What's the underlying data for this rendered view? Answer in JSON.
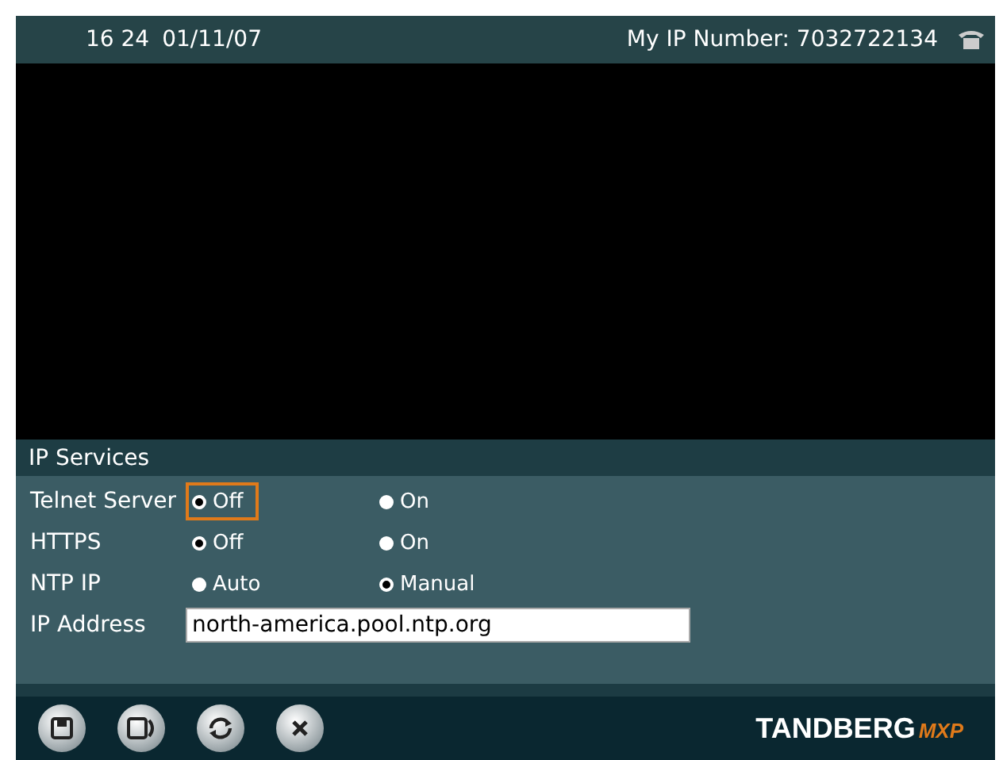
{
  "status_bar": {
    "time": "16 24",
    "date": "01/11/07",
    "ip_number": "My IP Number: 7032722134"
  },
  "panel": {
    "title": "IP Services",
    "rows": [
      {
        "kind": "radio",
        "label": "Telnet Server",
        "options": [
          {
            "label": "Off",
            "selected": true,
            "focused": true
          },
          {
            "label": "On",
            "selected": false,
            "focused": false
          }
        ]
      },
      {
        "kind": "radio",
        "label": "HTTPS",
        "options": [
          {
            "label": "Off",
            "selected": true,
            "focused": false
          },
          {
            "label": "On",
            "selected": false,
            "focused": false
          }
        ]
      },
      {
        "kind": "radio",
        "label": "NTP IP",
        "options": [
          {
            "label": "Auto",
            "selected": false,
            "focused": false
          },
          {
            "label": "Manual",
            "selected": true,
            "focused": false
          }
        ]
      },
      {
        "kind": "text",
        "label": "IP Address",
        "value": "north-america.pool.ntp.org"
      }
    ]
  },
  "toolbar": {
    "buttons": [
      {
        "kind": "save"
      },
      {
        "kind": "save-exit"
      },
      {
        "kind": "refresh"
      },
      {
        "kind": "close"
      }
    ]
  },
  "logo": {
    "brand": "TANDBERG",
    "product": "MXP"
  }
}
